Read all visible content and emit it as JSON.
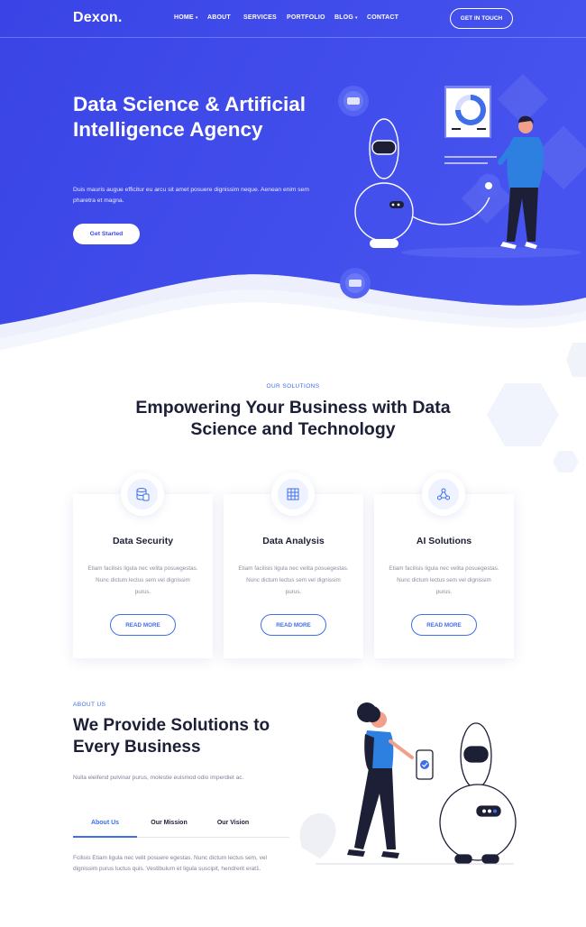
{
  "brand": {
    "name": "Dexon.",
    "accent": "#3f4be8",
    "accent_light": "#3f6ee8",
    "dark": "#1c1f35"
  },
  "nav": {
    "items": [
      {
        "label": "HOME",
        "caret": "▾"
      },
      {
        "label": "ABOUT"
      },
      {
        "label": "SERVICES"
      },
      {
        "label": "PORTFOLIO"
      },
      {
        "label": "BLOG",
        "caret": "▾"
      },
      {
        "label": "CONTACT"
      }
    ],
    "cta": "GET IN TOUCH"
  },
  "hero": {
    "title": "Data Science & Artificial Intelligence Agency",
    "description": "Duis mauris augue efficitur eu arcu sit amet posuere dignissim neque. Aenean enim sem pharetra et magna.",
    "button": "Get Started"
  },
  "solutions": {
    "kicker": "OUR SOLUTIONS",
    "title": "Empowering Your Business with Data Science and Technology",
    "cards": [
      {
        "icon": "database-icon",
        "title": "Data Security",
        "text": "Etiam facilisis ligula nec velita posuegestas. Nunc dictum lectus sem vel dignissim purus.",
        "button": "READ MORE"
      },
      {
        "icon": "data-analysis-icon",
        "title": "Data Analysis",
        "text": "Etiam facilisis ligula nec velita posuegestas. Nunc dictum lectus sem vel dignissim purus.",
        "button": "READ MORE"
      },
      {
        "icon": "network-nodes-icon",
        "title": "AI Solutions",
        "text": "Etiam facilisis ligula nec velita posuegestas. Nunc dictum lectus sem vel dignissim purus.",
        "button": "READ MORE"
      }
    ]
  },
  "about": {
    "kicker": "ABOUT US",
    "title": "We Provide Solutions to Every Business",
    "description": "Nulla eleifend pulvinar purus, molestie euismod odio imperdiet ac.",
    "tabs": [
      {
        "label": "About Us",
        "active": true
      },
      {
        "label": "Our Mission",
        "active": false
      },
      {
        "label": "Our Vision",
        "active": false
      }
    ],
    "text": "Fcilisis Etiam ligula nec velit posuere egestas. Nunc dictum lectus sem, vel dignissim purus luctus quis. Vestibulum et ligula suscipit, hendrerit erat1."
  }
}
